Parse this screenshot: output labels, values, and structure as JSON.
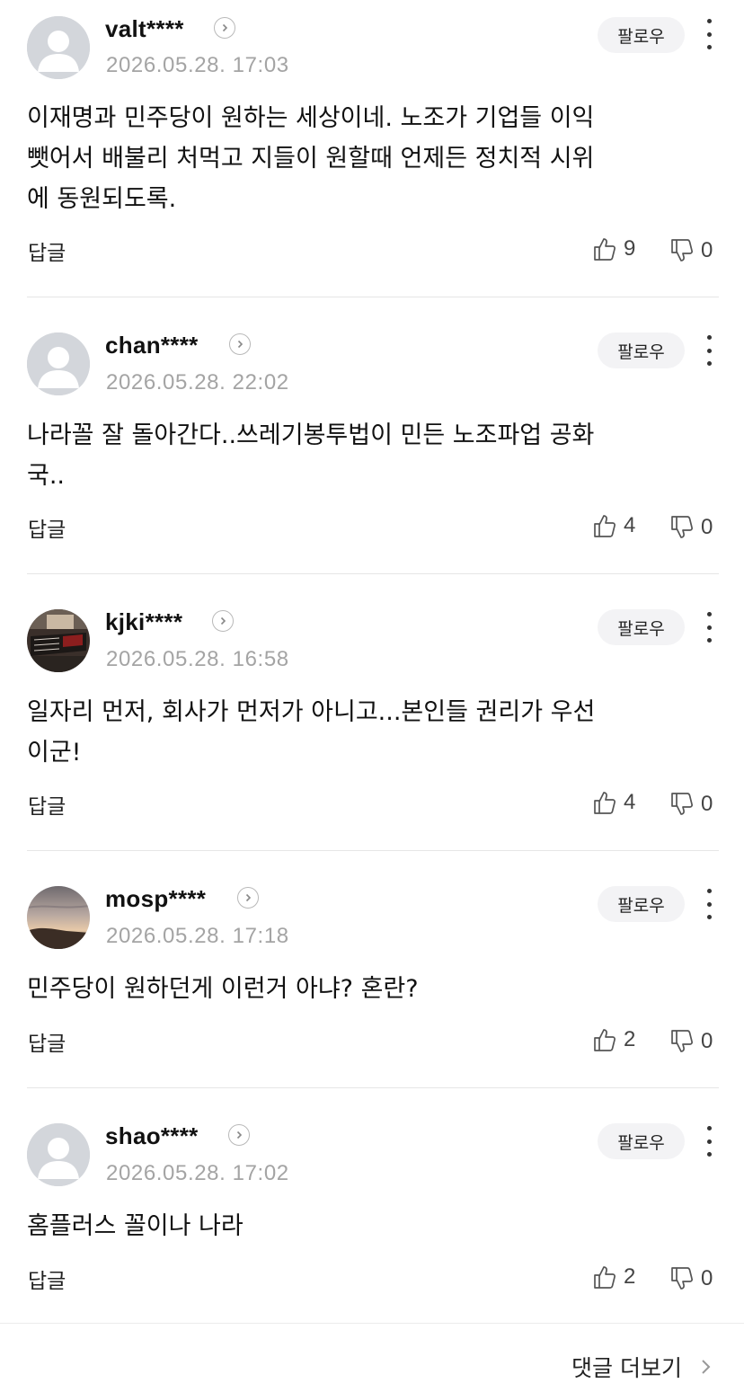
{
  "comments": [
    {
      "username": "valt****",
      "date": "2026.05.28. 17:03",
      "follow_label": "팔로우",
      "text_lines": [
        "이재명과 민주당이 원하는 세상이네. 노조가 기업들 이익",
        "뺏어서 배불리 처먹고 지들이 원할때 언제든 정치적 시위",
        "에 동원되도록."
      ],
      "reply_label": "답글",
      "likes": "9",
      "dislikes": "0",
      "avatar": "default-avatar"
    },
    {
      "username": "chan****",
      "date": "2026.05.28. 22:02",
      "follow_label": "팔로우",
      "text_lines": [
        "나라꼴 잘 돌아간다..쓰레기봉투법이 민든 노조파업 공화",
        "국.."
      ],
      "reply_label": "답글",
      "likes": "4",
      "dislikes": "0",
      "avatar": "default-avatar"
    },
    {
      "username": "kjki****",
      "date": "2026.05.28. 16:58",
      "follow_label": "팔로우",
      "text_lines": [
        "일자리 먼저, 회사가 먼저가 아니고...본인들 권리가 우선",
        "이군!"
      ],
      "reply_label": "답글",
      "likes": "4",
      "dislikes": "0",
      "avatar": "photo-avatar-dark"
    },
    {
      "username": "mosp****",
      "date": "2026.05.28. 17:18",
      "follow_label": "팔로우",
      "text_lines": [
        "민주당이 원하던게 이런거 아냐? 혼란?"
      ],
      "reply_label": "답글",
      "likes": "2",
      "dislikes": "0",
      "avatar": "photo-avatar-sunset"
    },
    {
      "username": "shao****",
      "date": "2026.05.28. 17:02",
      "follow_label": "팔로우",
      "text_lines": [
        "홈플러스 꼴이나 나라"
      ],
      "reply_label": "답글",
      "likes": "2",
      "dislikes": "0",
      "avatar": "default-avatar"
    }
  ],
  "footer": {
    "more_comments_label": "댓글 더보기"
  },
  "colors": {
    "date_gray": "#a4a4a4",
    "follow_bg": "#f3f3f5",
    "divider": "#e6e6e6"
  }
}
